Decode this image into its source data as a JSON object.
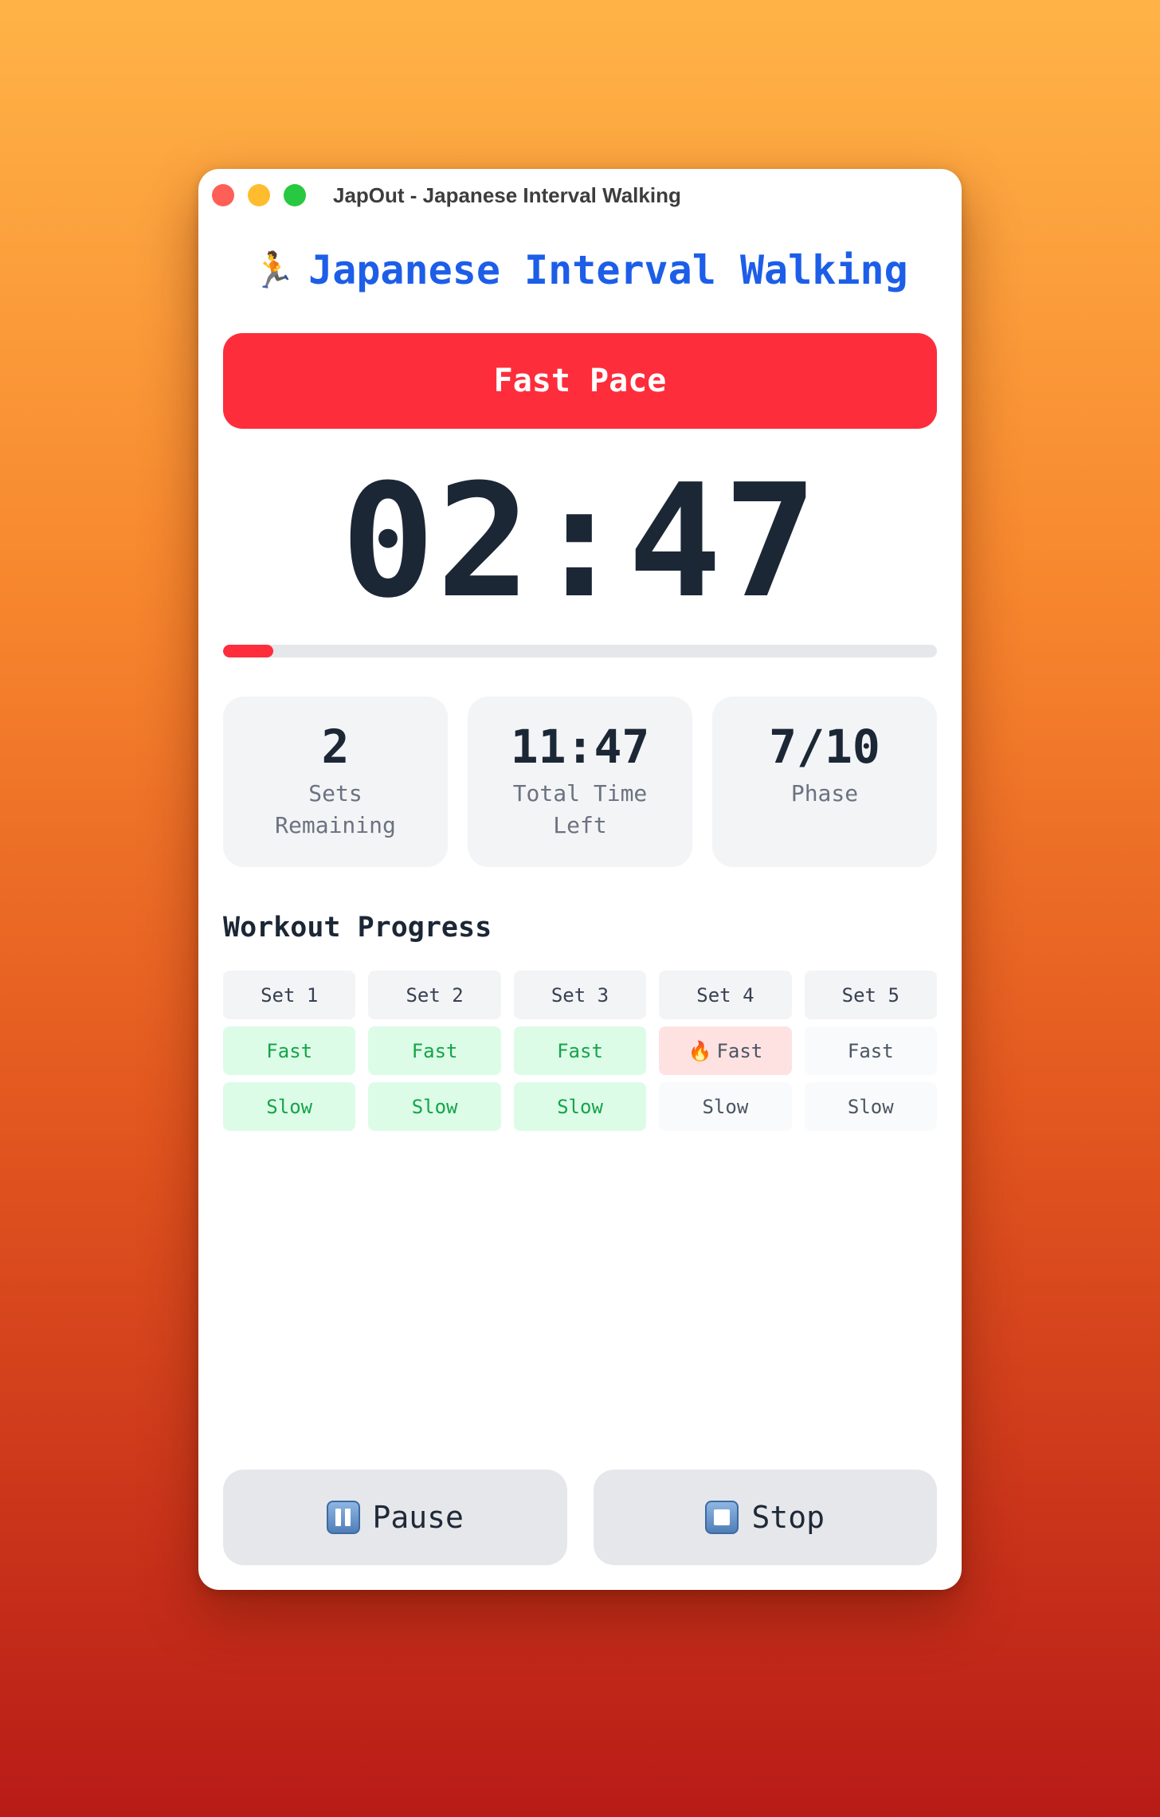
{
  "window": {
    "title": "JapOut - Japanese Interval Walking"
  },
  "header": {
    "icon": "runner-icon",
    "title": "Japanese Interval Walking"
  },
  "phase": {
    "label": "Fast Pace",
    "color": "#fd2d3c"
  },
  "timer": {
    "display": "02:47",
    "progress_fraction": 0.07
  },
  "stats": [
    {
      "value": "2",
      "label": "Sets Remaining"
    },
    {
      "value": "11:47",
      "label": "Total Time Left"
    },
    {
      "value": "7/10",
      "label": "Phase"
    }
  ],
  "workout_progress": {
    "title": "Workout Progress",
    "sets": [
      {
        "label": "Set 1",
        "fast": "Fast",
        "slow": "Slow",
        "fast_state": "done",
        "slow_state": "done"
      },
      {
        "label": "Set 2",
        "fast": "Fast",
        "slow": "Slow",
        "fast_state": "done",
        "slow_state": "done"
      },
      {
        "label": "Set 3",
        "fast": "Fast",
        "slow": "Slow",
        "fast_state": "done",
        "slow_state": "done"
      },
      {
        "label": "Set 4",
        "fast": "Fast",
        "slow": "Slow",
        "fast_state": "active",
        "slow_state": "pending"
      },
      {
        "label": "Set 5",
        "fast": "Fast",
        "slow": "Slow",
        "fast_state": "pending",
        "slow_state": "pending"
      }
    ]
  },
  "controls": {
    "pause_label": "Pause",
    "pause_icon": "pause-icon",
    "stop_label": "Stop",
    "stop_icon": "stop-icon"
  },
  "colors": {
    "accent_blue": "#1d5ee8",
    "fast_red": "#fd2d3c",
    "done_green": "#16a34a"
  }
}
